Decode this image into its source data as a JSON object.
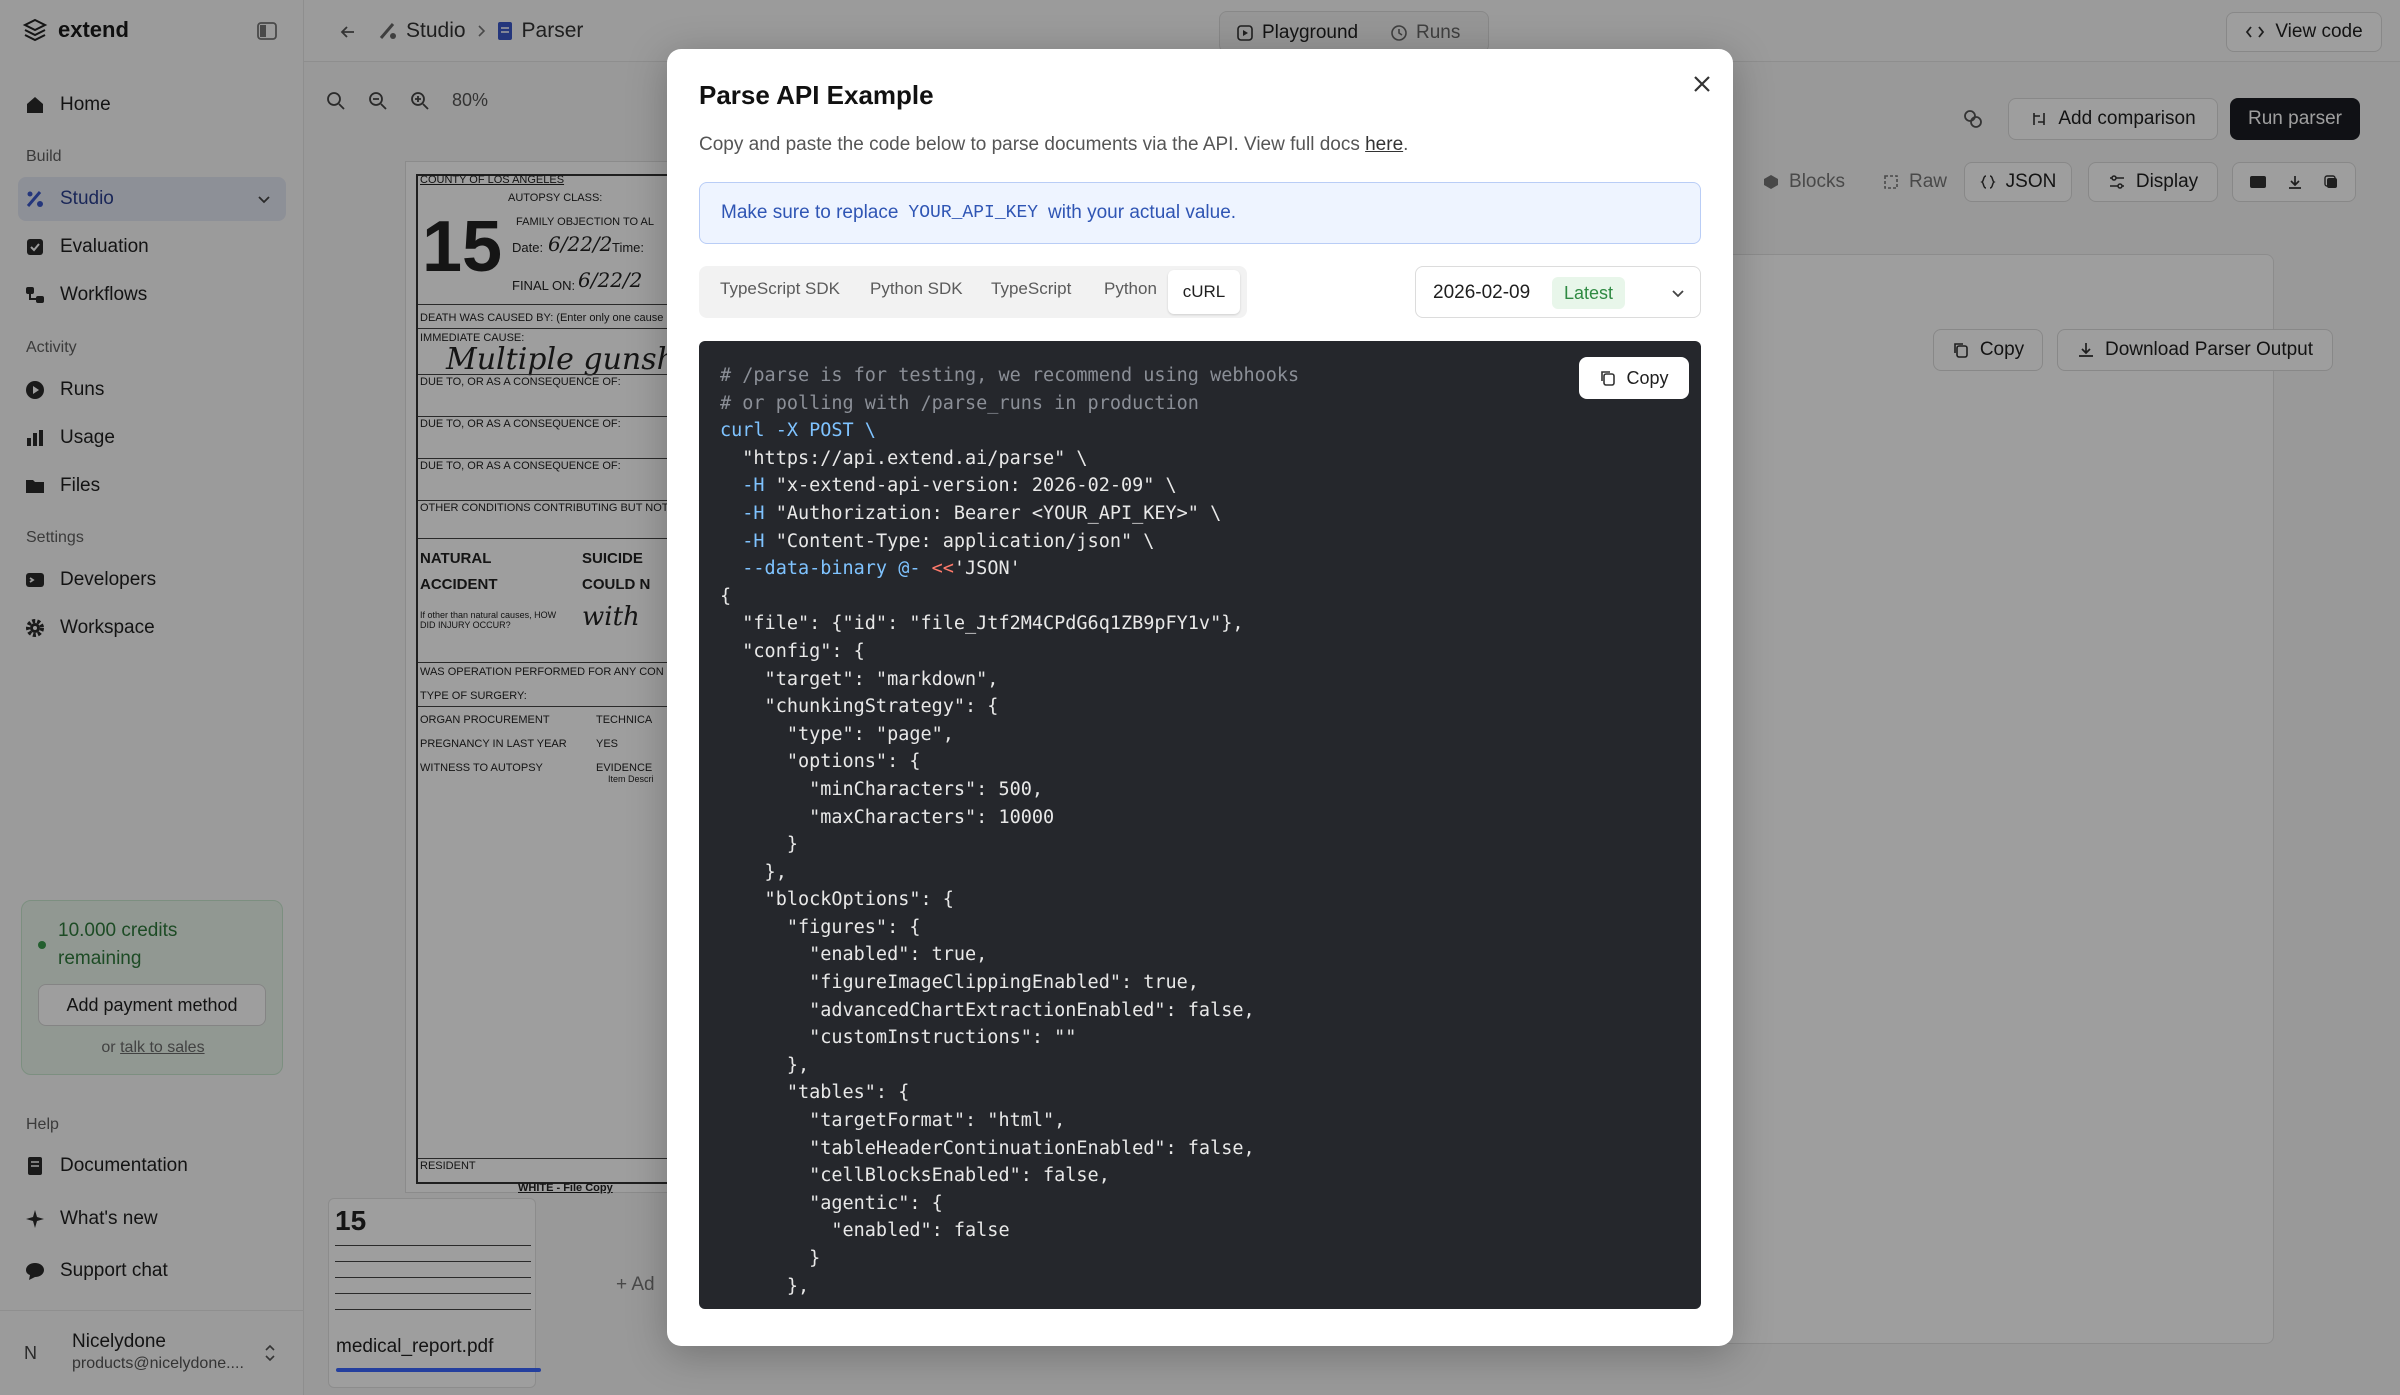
{
  "sidebar": {
    "logo": "extend",
    "sections": {
      "build": "Build",
      "activity": "Activity",
      "settings": "Settings",
      "help": "Help"
    },
    "items": [
      {
        "label": "Home",
        "icon": "home-icon"
      },
      {
        "label": "Studio",
        "icon": "studio-icon"
      },
      {
        "label": "Evaluation",
        "icon": "evaluation-icon"
      },
      {
        "label": "Workflows",
        "icon": "workflows-icon"
      },
      {
        "label": "Runs",
        "icon": "play-icon"
      },
      {
        "label": "Usage",
        "icon": "usage-icon"
      },
      {
        "label": "Files",
        "icon": "folder-icon"
      },
      {
        "label": "Developers",
        "icon": "developers-icon"
      },
      {
        "label": "Workspace",
        "icon": "gear-icon"
      },
      {
        "label": "Documentation",
        "icon": "book-icon"
      },
      {
        "label": "What's new",
        "icon": "sparkle-icon"
      },
      {
        "label": "Support chat",
        "icon": "chat-icon"
      }
    ],
    "credits": {
      "text": "10.000 credits remaining",
      "button": "Add payment method",
      "or": "or",
      "sales_link": "talk to sales"
    },
    "user": {
      "initial": "N",
      "name": "Nicelydone",
      "email": "products@nicelydone...."
    }
  },
  "topbar": {
    "crumb_studio": "Studio",
    "crumb_parser": "Parser",
    "tab_playground": "Playground",
    "tab_runs": "Runs",
    "view_code": "View code"
  },
  "main": {
    "zoom": "80%",
    "add_comparison": "Add comparison",
    "run_parser": "Run parser",
    "view_blocks": "Blocks",
    "view_raw": "Raw",
    "view_json": "JSON",
    "display": "Display",
    "copy": "Copy",
    "download": "Download Parser Output",
    "thumb_name": "medical_report.pdf",
    "add_more": "Ad",
    "document": {
      "county": "COUNTY OF LOS ANGELES",
      "number": "15",
      "autopsy_class": "AUTOPSY CLASS:",
      "family_obj": "FAMILY OBJECTION TO AL",
      "date_label": "Date:",
      "date_value": "6/22/2",
      "time_label": "Time:",
      "final_on": "FINAL ON:",
      "final_value": "6/22/2",
      "death_caused": "DEATH WAS CAUSED BY: (Enter only one cause",
      "immediate": "IMMEDIATE CAUSE:",
      "immediate_value": "Multiple gunshot",
      "due_to": "DUE TO, OR AS A CONSEQUENCE OF:",
      "other_conditions": "OTHER CONDITIONS CONTRIBUTING BUT NOT REL",
      "natural": "NATURAL",
      "suicide": "SUICIDE",
      "accident": "ACCIDENT",
      "could_not": "COULD N",
      "injury_q": "If other than natural causes, HOW DID INJURY OCCUR?",
      "injury_value": "with",
      "operation": "WAS OPERATION PERFORMED FOR ANY CON",
      "surgery": "TYPE OF SURGERY:",
      "organ": "ORGAN PROCUREMENT",
      "technical": "TECHNICA",
      "pregnancy": "PREGNANCY IN LAST YEAR",
      "yes": "YES",
      "witness": "WITNESS TO AUTOPSY",
      "evidence": "EVIDENCE",
      "item_desc": "Item Descri",
      "resident": "RESIDENT",
      "white_copy": "WHITE - File Copy"
    }
  },
  "modal": {
    "title": "Parse API Example",
    "description": "Copy and paste the code below to parse documents via the API. View full docs",
    "docs_link": "here",
    "info_prefix": "Make sure to replace",
    "info_code": "YOUR_API_KEY",
    "info_suffix": "with your actual value.",
    "tabs": [
      "TypeScript SDK",
      "Python SDK",
      "TypeScript",
      "Python",
      "cURL"
    ],
    "active_tab": "cURL",
    "version": "2026-02-09",
    "version_badge": "Latest",
    "copy": "Copy",
    "code": [
      "# /parse is for testing, we recommend using webhooks",
      "# or polling with /parse_runs in production",
      "curl -X POST \\",
      "  \"https://api.extend.ai/parse\" \\",
      "  -H \"x-extend-api-version: 2026-02-09\" \\",
      "  -H \"Authorization: Bearer <YOUR_API_KEY>\" \\",
      "  -H \"Content-Type: application/json\" \\",
      "  --data-binary @- <<'JSON'",
      "{",
      "  \"file\": {\"id\": \"file_Jtf2M4CPdG6q1ZB9pFY1v\"},",
      "  \"config\": {",
      "    \"target\": \"markdown\",",
      "    \"chunkingStrategy\": {",
      "      \"type\": \"page\",",
      "      \"options\": {",
      "        \"minCharacters\": 500,",
      "        \"maxCharacters\": 10000",
      "      }",
      "    },",
      "    \"blockOptions\": {",
      "      \"figures\": {",
      "        \"enabled\": true,",
      "        \"figureImageClippingEnabled\": true,",
      "        \"advancedChartExtractionEnabled\": false,",
      "        \"customInstructions\": \"\"",
      "      },",
      "      \"tables\": {",
      "        \"targetFormat\": \"html\",",
      "        \"tableHeaderContinuationEnabled\": false,",
      "        \"cellBlocksEnabled\": false,",
      "        \"agentic\": {",
      "          \"enabled\": false",
      "        }",
      "      },"
    ]
  }
}
